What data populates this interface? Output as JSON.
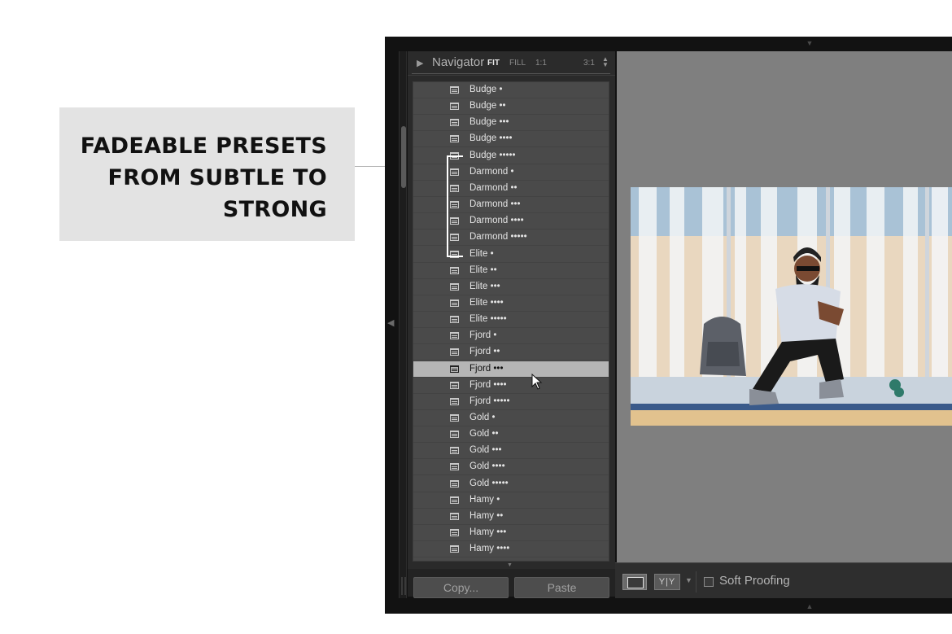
{
  "callout": {
    "lines": [
      "FADEABLE PRESETS",
      "FROM SUBTLE TO",
      "STRONG"
    ]
  },
  "navigator": {
    "title": "Navigator",
    "zoom_options": [
      "FIT",
      "FILL",
      "1:1",
      "3:1"
    ],
    "active_zoom": "FIT"
  },
  "presets": [
    "Budge •",
    "Budge ••",
    "Budge •••",
    "Budge ••••",
    "Budge •••••",
    "Darmond •",
    "Darmond ••",
    "Darmond •••",
    "Darmond ••••",
    "Darmond •••••",
    "Elite •",
    "Elite ••",
    "Elite •••",
    "Elite ••••",
    "Elite •••••",
    "Fjord •",
    "Fjord ••",
    "Fjord •••",
    "Fjord ••••",
    "Fjord •••••",
    "Gold •",
    "Gold ••",
    "Gold •••",
    "Gold ••••",
    "Gold •••••",
    "Hamy •",
    "Hamy ••",
    "Hamy •••",
    "Hamy ••••"
  ],
  "selected_preset": "Fjord •••",
  "buttons": {
    "copy": "Copy...",
    "paste": "Paste"
  },
  "toolbar": {
    "yy_label": "Y|Y",
    "soft_proofing": "Soft Proofing",
    "soft_proofing_checked": false
  },
  "colors": {
    "panel": "#2a2a2a",
    "list": "#4a4a4a",
    "selected_row": "#b5b5b5",
    "canvas": "#7f7f7f",
    "callout_bg": "#e3e3e3"
  }
}
